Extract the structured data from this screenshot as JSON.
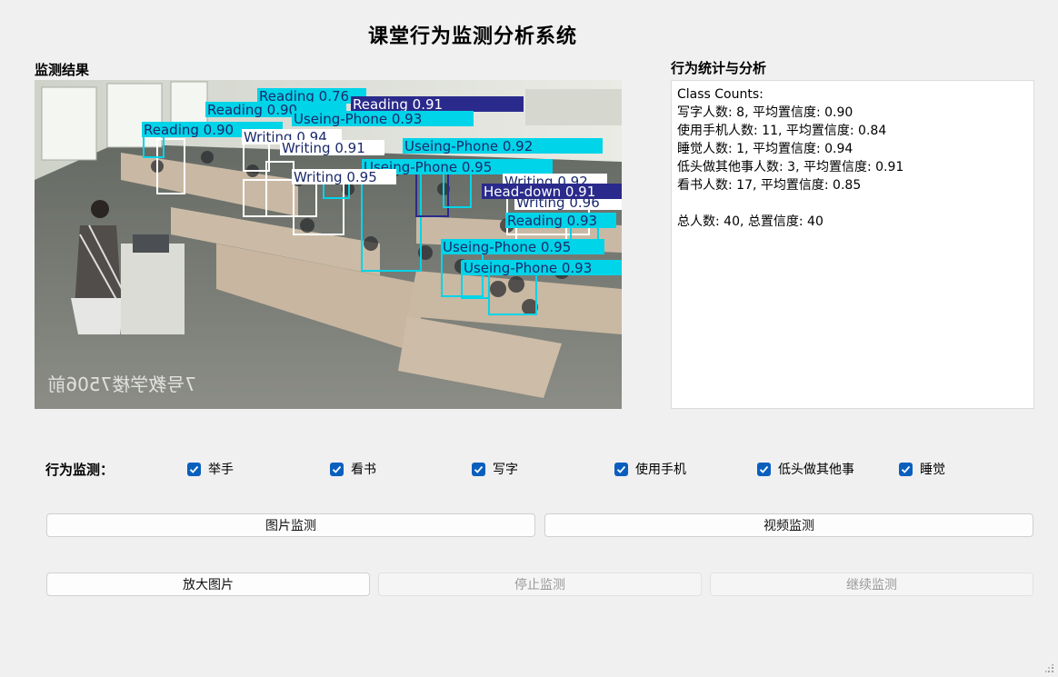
{
  "app": {
    "title": "课堂行为监测分析系统"
  },
  "panels": {
    "result_label": "监测结果",
    "stats_label": "行为统计与分析"
  },
  "stats": {
    "text": "Class Counts:\n写字人数: 8, 平均置信度: 0.90\n使用手机人数: 11, 平均置信度: 0.84\n睡觉人数: 1, 平均置信度: 0.94\n低头做其他事人数: 3, 平均置信度: 0.91\n看书人数: 17, 平均置信度: 0.85\n\n总人数: 40, 总置信度: 40"
  },
  "image": {
    "watermark": "7号教学楼7506前",
    "detections": [
      {
        "label": "Reading 0.76",
        "color": "#00d4e8"
      },
      {
        "label": "Reading 0.91",
        "color": "#2a2a8c"
      },
      {
        "label": "Reading 0.90",
        "color": "#00d4e8"
      },
      {
        "label": "Reading 0.90",
        "color": "#00d4e8"
      },
      {
        "label": "Useing-Phone 0.93",
        "color": "#00d4e8"
      },
      {
        "label": "Useing-Phone 0.92",
        "color": "#00d4e8"
      },
      {
        "label": "Useing-Phone 0.95",
        "color": "#00d4e8"
      },
      {
        "label": "Writing 0.94",
        "color": "#ffffff"
      },
      {
        "label": "Writing 0.91",
        "color": "#ffffff"
      },
      {
        "label": "Writing 0.95",
        "color": "#ffffff"
      },
      {
        "label": "Writing 0.92",
        "color": "#ffffff"
      },
      {
        "label": "Writing 0.96",
        "color": "#ffffff"
      },
      {
        "label": "Head-down 0.91",
        "color": "#2a2a8c"
      },
      {
        "label": "Reading 0.93",
        "color": "#00d4e8"
      },
      {
        "label": "Useing-Phone 0.95",
        "color": "#00d4e8"
      },
      {
        "label": "Useing-Phone 0.93",
        "color": "#00d4e8"
      }
    ]
  },
  "behaviors": {
    "label": "行为监测：",
    "items": [
      {
        "label": "举手",
        "checked": true
      },
      {
        "label": "看书",
        "checked": true
      },
      {
        "label": "写字",
        "checked": true
      },
      {
        "label": "使用手机",
        "checked": true
      },
      {
        "label": "低头做其他事",
        "checked": true
      },
      {
        "label": "睡觉",
        "checked": true
      }
    ]
  },
  "buttons": {
    "image_detect": "图片监测",
    "video_detect": "视频监测",
    "enlarge": "放大图片",
    "stop": "停止监测",
    "resume": "继续监测"
  },
  "colors": {
    "accent": "#0a5fbd",
    "cyan_box": "#00d4e8",
    "navy_box": "#2a2a8c",
    "white_box": "#ffffff"
  }
}
